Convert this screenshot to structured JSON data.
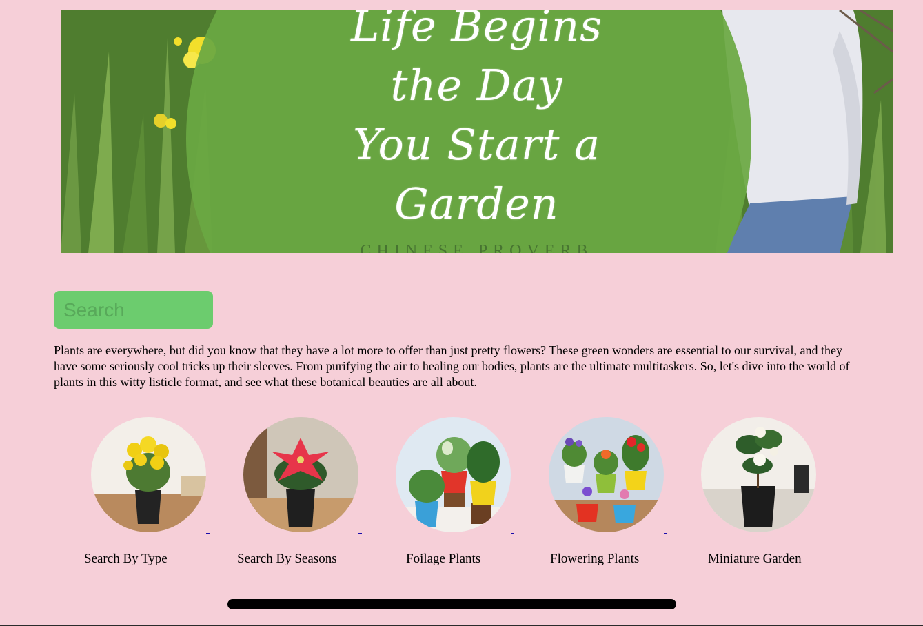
{
  "banner": {
    "quote_lines": [
      "Life Begins",
      "the Day",
      "You Start a",
      "Garden"
    ],
    "attribution": "CHINESE PROVERB"
  },
  "search": {
    "placeholder": "Search",
    "value": ""
  },
  "intro": {
    "text": "Plants are everywhere, but did you know that they have a lot more to offer than just pretty flowers? These green wonders are essential to our survival, and they have some seriously cool tricks up their sleeves. From purifying the air to healing our bodies, plants are the ultimate multitaskers. So, let's dive into the world of plants in this witty listicle format, and see what these botanical beauties are all about."
  },
  "categories": [
    {
      "label": "Search By Type",
      "image": "yellow-marigold-pot"
    },
    {
      "label": "Search By Seasons",
      "image": "red-poinsettia-pot"
    },
    {
      "label": "Foilage Plants",
      "image": "foliage-plants-pots"
    },
    {
      "label": "Flowering Plants",
      "image": "flowering-plants-pots"
    },
    {
      "label": "Miniature Garden",
      "image": "white-gardenia-pot"
    }
  ],
  "colors": {
    "page_background": "#f6cfd8",
    "search_background": "#6ccc6e",
    "banner_circle": "#6aa843",
    "link_color": "#1a0dab"
  }
}
